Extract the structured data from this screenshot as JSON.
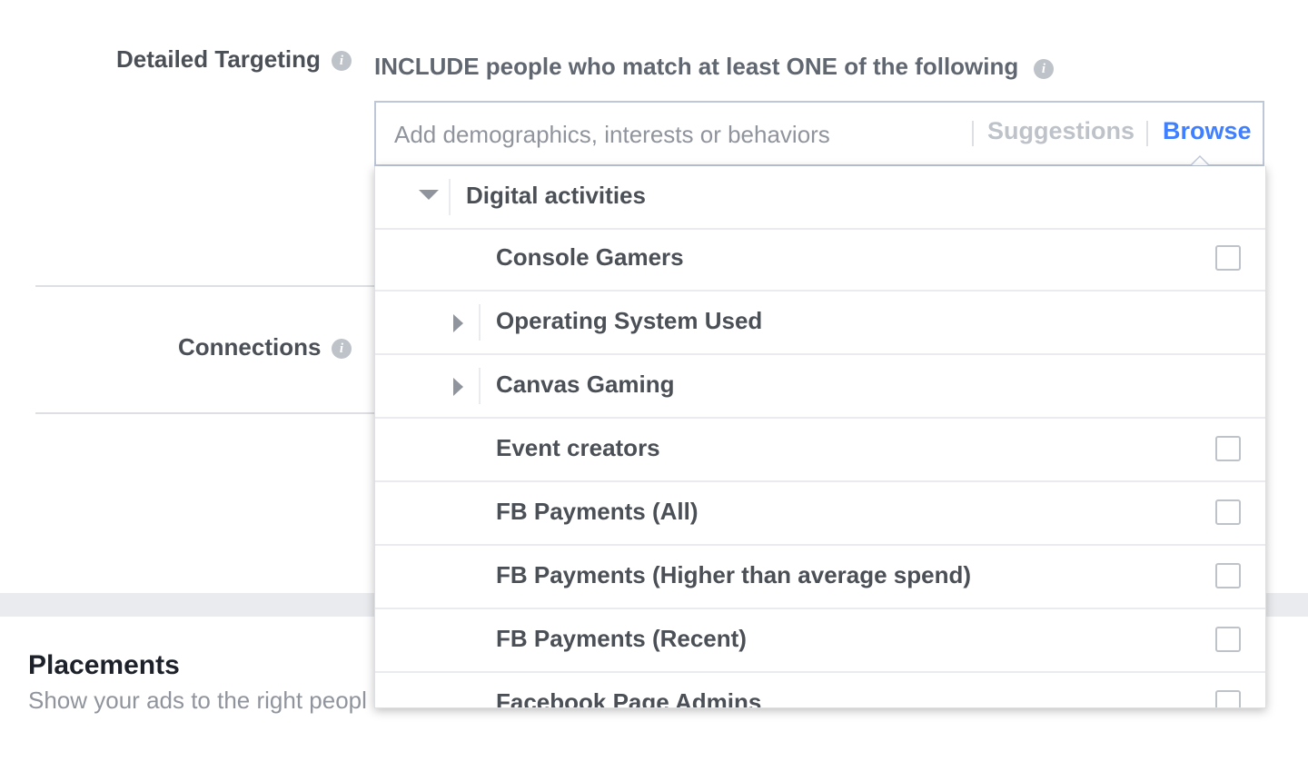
{
  "detailed_targeting": {
    "label": "Detailed Targeting",
    "include_text": "INCLUDE people who match at least ONE of the following"
  },
  "search": {
    "placeholder": "Add demographics, interests or behaviors",
    "suggestions_label": "Suggestions",
    "browse_label": "Browse"
  },
  "connections": {
    "label": "Connections"
  },
  "placements": {
    "title": "Placements",
    "subtitle": "Show your ads to the right peopl"
  },
  "dropdown": {
    "category": "Digital activities",
    "items": [
      {
        "label": "Console Gamers",
        "type": "checkbox"
      },
      {
        "label": "Operating System Used",
        "type": "expandable"
      },
      {
        "label": "Canvas Gaming",
        "type": "expandable"
      },
      {
        "label": "Event creators",
        "type": "checkbox"
      },
      {
        "label": "FB Payments (All)",
        "type": "checkbox"
      },
      {
        "label": "FB Payments (Higher than average spend)",
        "type": "checkbox"
      },
      {
        "label": "FB Payments (Recent)",
        "type": "checkbox"
      },
      {
        "label": "Facebook Page Admins",
        "type": "checkbox"
      }
    ]
  },
  "colors": {
    "browse_active": "#4080ff",
    "suggestions_inactive": "#bec2c9",
    "text": "#4b4f56"
  },
  "icons": {
    "info": "info-icon",
    "collapse": "triangle-down-icon",
    "expand": "triangle-right-icon"
  }
}
